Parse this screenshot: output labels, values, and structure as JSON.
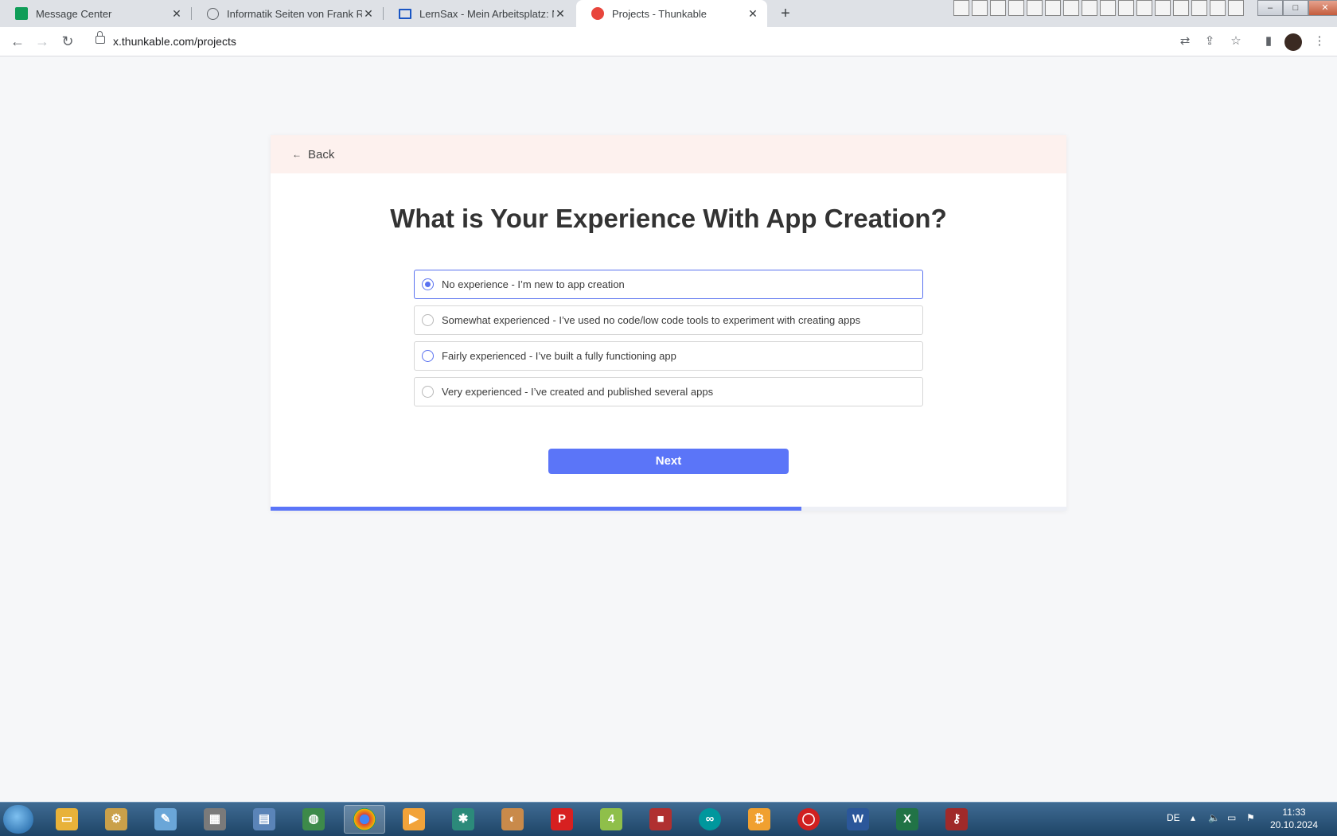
{
  "browser": {
    "tabs": [
      {
        "title": "Message Center",
        "favicon": "sheets-icon",
        "color": "#0f9d58"
      },
      {
        "title": "Informatik Seiten von Frank Rost",
        "favicon": "globe-icon",
        "color": "#5f6368"
      },
      {
        "title": "LernSax - Mein Arbeitsplatz: Noti",
        "favicon": "laptop-icon",
        "color": "#1a56c4"
      },
      {
        "title": "Projects - Thunkable",
        "favicon": "thunkable-icon",
        "color": "#e8453c"
      }
    ],
    "url": "x.thunkable.com/projects"
  },
  "page": {
    "back_label": "Back",
    "heading": "What is Your Experience With App Creation?",
    "options": [
      {
        "label": "No experience - I’m new to app creation",
        "selected": true
      },
      {
        "label": "Somewhat experienced - I’ve used no code/low code tools to experiment with creating apps",
        "selected": false
      },
      {
        "label": "Fairly experienced - I’ve built a fully functioning app",
        "selected": false
      },
      {
        "label": "Very experienced - I’ve created and published several apps",
        "selected": false
      }
    ],
    "next_label": "Next",
    "progress_fraction": 0.667,
    "accent_color": "#5b75f8"
  },
  "taskbar": {
    "language": "DE",
    "time": "11:33",
    "date": "20.10.2024"
  }
}
